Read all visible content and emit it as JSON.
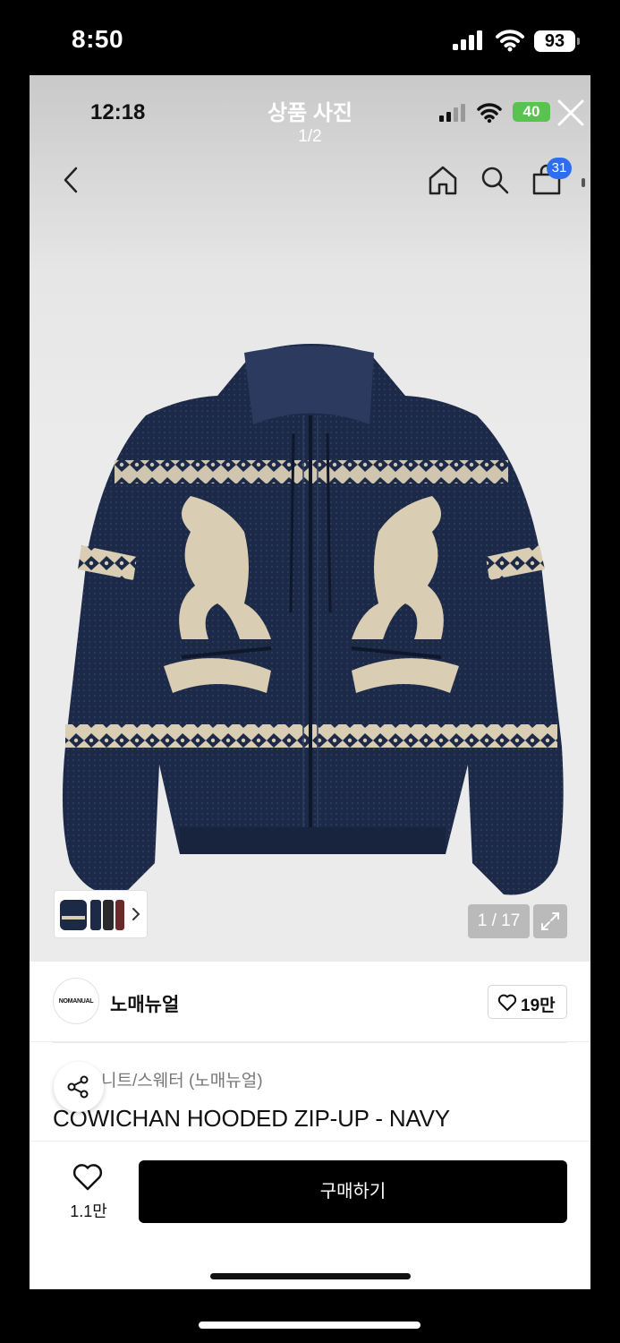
{
  "outer_status": {
    "time": "8:50",
    "battery": "93"
  },
  "viewer": {
    "time": "12:18",
    "title": "상품 사진",
    "counter": "1/2",
    "battery": "40"
  },
  "nav": {
    "cart_count": "31"
  },
  "gallery": {
    "image_counter": "1 / 17"
  },
  "brand": {
    "logo_text": "NOMANUAL",
    "name": "노매뉴얼",
    "likes": "19만"
  },
  "product": {
    "category": "니트/스웨터 (노매뉴얼)",
    "title": "COWICHAN HOODED ZIP-UP - NAVY"
  },
  "bottom": {
    "wish_count": "1.1만",
    "buy_label": "구매하기"
  },
  "colors": {
    "accent_badge": "#2f6df0",
    "buy_button": "#000000",
    "sweater_navy": "#1d2a47",
    "pattern_cream": "#d9cdb3"
  },
  "icons": [
    "close-icon",
    "back-icon",
    "home-icon",
    "search-icon",
    "bag-icon",
    "chevron-right-icon",
    "expand-icon",
    "heart-icon",
    "share-icon"
  ]
}
